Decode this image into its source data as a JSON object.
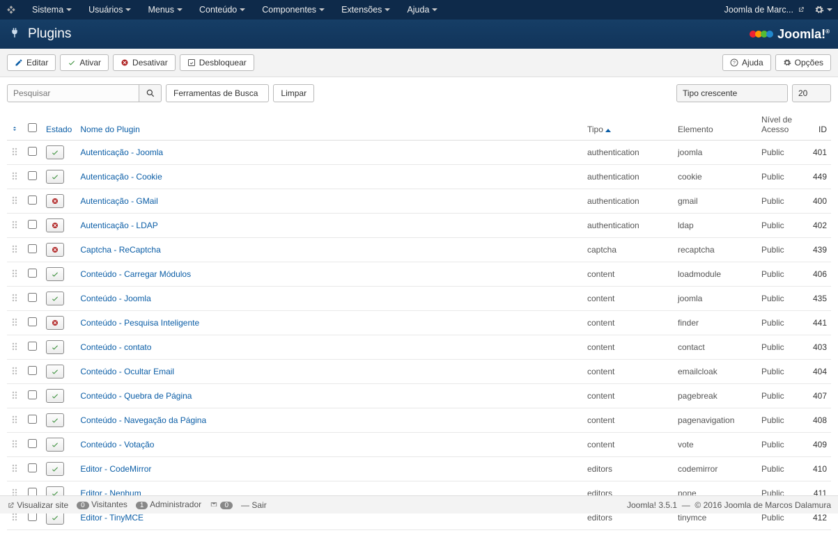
{
  "topbar": {
    "menus": [
      "Sistema",
      "Usuários",
      "Menus",
      "Conteúdo",
      "Componentes",
      "Extensões",
      "Ajuda"
    ],
    "sitename": "Joomla de Marc..."
  },
  "header": {
    "title": "Plugins",
    "brand": "Joomla!"
  },
  "toolbar": {
    "edit": "Editar",
    "activate": "Ativar",
    "deactivate": "Desativar",
    "unlock": "Desbloquear",
    "help": "Ajuda",
    "options": "Opções"
  },
  "filters": {
    "search_placeholder": "Pesquisar",
    "tools": "Ferramentas de Busca",
    "clear": "Limpar",
    "sort": "Tipo crescente",
    "limit": "20"
  },
  "columns": {
    "status": "Estado",
    "name": "Nome do Plugin",
    "type": "Tipo",
    "element": "Elemento",
    "access": "Nível de Acesso",
    "id": "ID"
  },
  "rows": [
    {
      "on": true,
      "name": "Autenticação - Joomla",
      "type": "authentication",
      "element": "joomla",
      "access": "Public",
      "id": 401
    },
    {
      "on": true,
      "name": "Autenticação - Cookie",
      "type": "authentication",
      "element": "cookie",
      "access": "Public",
      "id": 449
    },
    {
      "on": false,
      "name": "Autenticação - GMail",
      "type": "authentication",
      "element": "gmail",
      "access": "Public",
      "id": 400
    },
    {
      "on": false,
      "name": "Autenticação - LDAP",
      "type": "authentication",
      "element": "ldap",
      "access": "Public",
      "id": 402
    },
    {
      "on": false,
      "name": "Captcha - ReCaptcha",
      "type": "captcha",
      "element": "recaptcha",
      "access": "Public",
      "id": 439
    },
    {
      "on": true,
      "name": "Conteúdo - Carregar Módulos",
      "type": "content",
      "element": "loadmodule",
      "access": "Public",
      "id": 406
    },
    {
      "on": true,
      "name": "Conteúdo - Joomla",
      "type": "content",
      "element": "joomla",
      "access": "Public",
      "id": 435
    },
    {
      "on": false,
      "name": "Conteúdo - Pesquisa Inteligente",
      "type": "content",
      "element": "finder",
      "access": "Public",
      "id": 441
    },
    {
      "on": true,
      "name": "Conteúdo - contato",
      "type": "content",
      "element": "contact",
      "access": "Public",
      "id": 403
    },
    {
      "on": true,
      "name": "Conteúdo - Ocultar Email",
      "type": "content",
      "element": "emailcloak",
      "access": "Public",
      "id": 404
    },
    {
      "on": true,
      "name": "Conteúdo - Quebra de Página",
      "type": "content",
      "element": "pagebreak",
      "access": "Public",
      "id": 407
    },
    {
      "on": true,
      "name": "Conteúdo - Navegação da Página",
      "type": "content",
      "element": "pagenavigation",
      "access": "Public",
      "id": 408
    },
    {
      "on": true,
      "name": "Conteúdo - Votação",
      "type": "content",
      "element": "vote",
      "access": "Public",
      "id": 409
    },
    {
      "on": true,
      "name": "Editor - CodeMirror",
      "type": "editors",
      "element": "codemirror",
      "access": "Public",
      "id": 410
    },
    {
      "on": true,
      "name": "Editor - Nenhum",
      "type": "editors",
      "element": "none",
      "access": "Public",
      "id": 411
    },
    {
      "on": true,
      "name": "Editor - TinyMCE",
      "type": "editors",
      "element": "tinymce",
      "access": "Public",
      "id": 412
    }
  ],
  "footer": {
    "preview": "Visualizar site",
    "visitors_count": "0",
    "visitors": "Visitantes",
    "admins_count": "1",
    "admin": "Administrador",
    "msgs_count": "0",
    "logout": "Sair",
    "version": "Joomla! 3.5.1",
    "copyright": "© 2016 Joomla de Marcos Dalamura"
  },
  "colors": {
    "link": "#0a5da6",
    "nav": "#0e2a4a",
    "header": "#163659"
  }
}
